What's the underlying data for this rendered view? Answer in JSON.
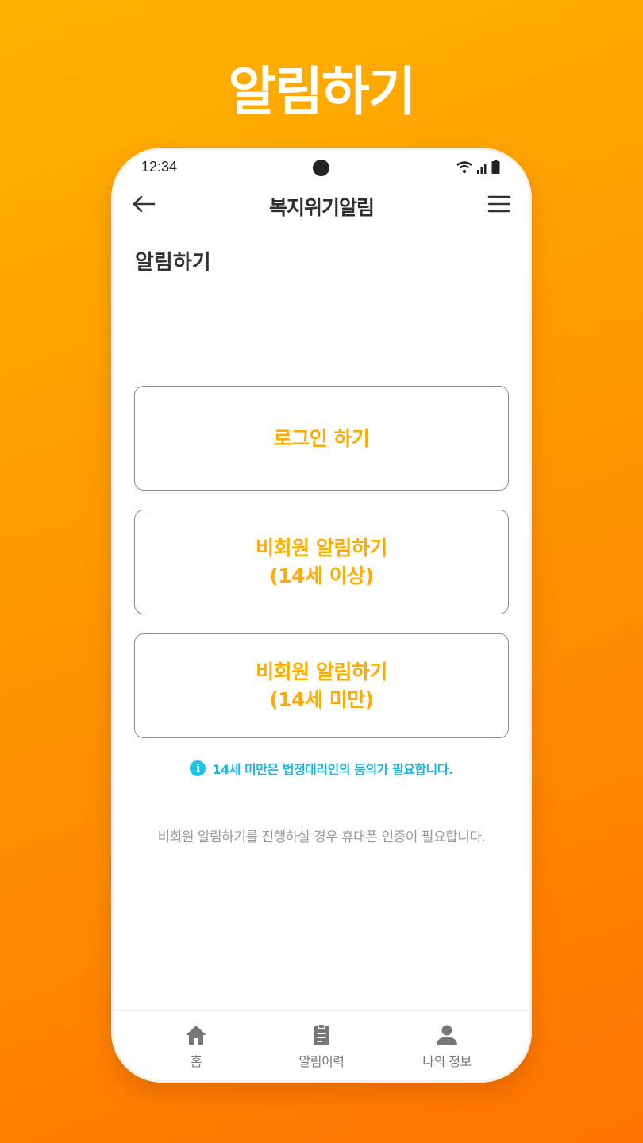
{
  "promo": {
    "title": "알림하기"
  },
  "status_bar": {
    "time": "12:34"
  },
  "app_bar": {
    "title": "복지위기알림"
  },
  "page": {
    "heading": "알림하기"
  },
  "options": [
    {
      "line1": "로그인 하기",
      "line2": ""
    },
    {
      "line1": "비회원 알림하기",
      "line2": "(14세 이상)"
    },
    {
      "line1": "비회원 알림하기",
      "line2": "(14세 미만)"
    }
  ],
  "notice": {
    "icon": "info-icon",
    "text": "14세 미만은 법정대리인의 동의가 필요합니다."
  },
  "helper": {
    "text": "비회원 알림하기를 진행하실 경우 휴대폰 인증이 필요합니다."
  },
  "bottom_nav": [
    {
      "label": "홈",
      "icon": "home-icon"
    },
    {
      "label": "알림이력",
      "icon": "clipboard-icon"
    },
    {
      "label": "나의 정보",
      "icon": "person-icon"
    }
  ],
  "colors": {
    "accent": "#ffab00",
    "info": "#1cb6e0",
    "background_start": "#ffb300",
    "background_end": "#ff7400"
  }
}
